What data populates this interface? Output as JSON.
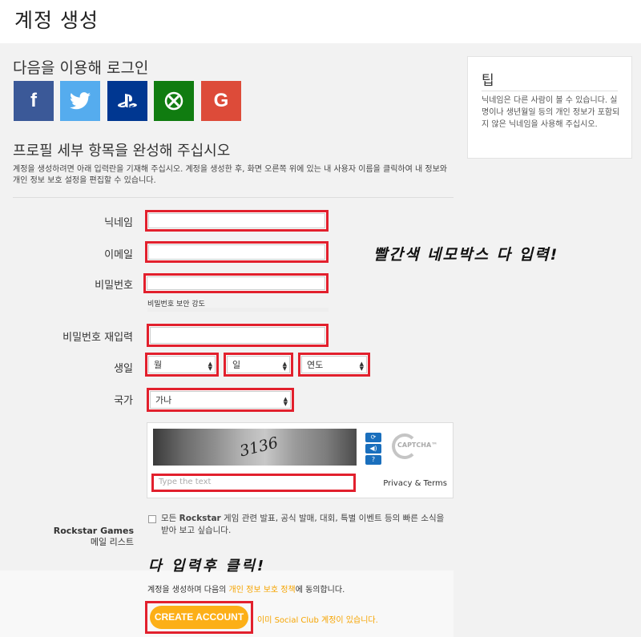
{
  "header": {
    "title": "계정 생성"
  },
  "social": {
    "title": "다음을 이용해 로그인",
    "buttons": [
      {
        "name": "Facebook",
        "glyph": "f"
      },
      {
        "name": "Twitter",
        "glyph": "t"
      },
      {
        "name": "PlayStation",
        "glyph": "PS"
      },
      {
        "name": "Xbox",
        "glyph": "⊗"
      },
      {
        "name": "Google",
        "glyph": "G"
      }
    ]
  },
  "profile": {
    "title": "프로필 세부 항목을 완성해 주십시오",
    "desc": "계정을 생성하려면 아래 입력란을 기재해 주십시오. 계정을 생성한 후, 화면 오른쪽 위에 있는 내 사용자 이름을 클릭하여 내 정보와 개인 정보 보호 설정을 편집할 수 있습니다."
  },
  "tip": {
    "title": "팁",
    "text": "닉네임은 다른 사람이 볼 수 있습니다. 실명이나 생년월일 등의 개인 정보가 포함되지 않은 닉네임을 사용해 주십시오."
  },
  "form": {
    "nickname_label": "닉네임",
    "email_label": "이메일",
    "password_label": "비밀번호",
    "password_strength_label": "비밀번호 보안 강도",
    "password_confirm_label": "비밀번호 재입력",
    "birth_label": "생일",
    "birth_month": "월",
    "birth_day": "일",
    "birth_year": "연도",
    "country_label": "국가",
    "country_value": "가나"
  },
  "captcha": {
    "image_text": "3136",
    "placeholder": "Type the text",
    "privacy_terms": "Privacy & Terms",
    "logo_text": "CAPTCHA™"
  },
  "newsletter": {
    "label_line1": "Rockstar Games",
    "label_line2": "메일 리스트",
    "text_prefix": "모든 ",
    "text_brand": "Rockstar",
    "text_rest": " 게임 관련 발표, 공식 발매, 대회, 특별 이벤트 등의 빠른 소식을 받아 보고 싶습니다.",
    "checked": false
  },
  "annotations": {
    "fill_red_boxes": "빨간색 네모박스 다 입력!",
    "click_after": "다 입력후 클릭!"
  },
  "footer": {
    "agree_prefix": "계정을 생성하며 다음의 ",
    "agree_link": "개인 정보 보호 정책",
    "agree_suffix": "에 동의합니다.",
    "create_button": "CREATE ACCOUNT",
    "already_account": "이미 Social Club 계정이 있습니다."
  },
  "colors": {
    "highlight": "#e2202d",
    "accent": "#fcaf17"
  }
}
